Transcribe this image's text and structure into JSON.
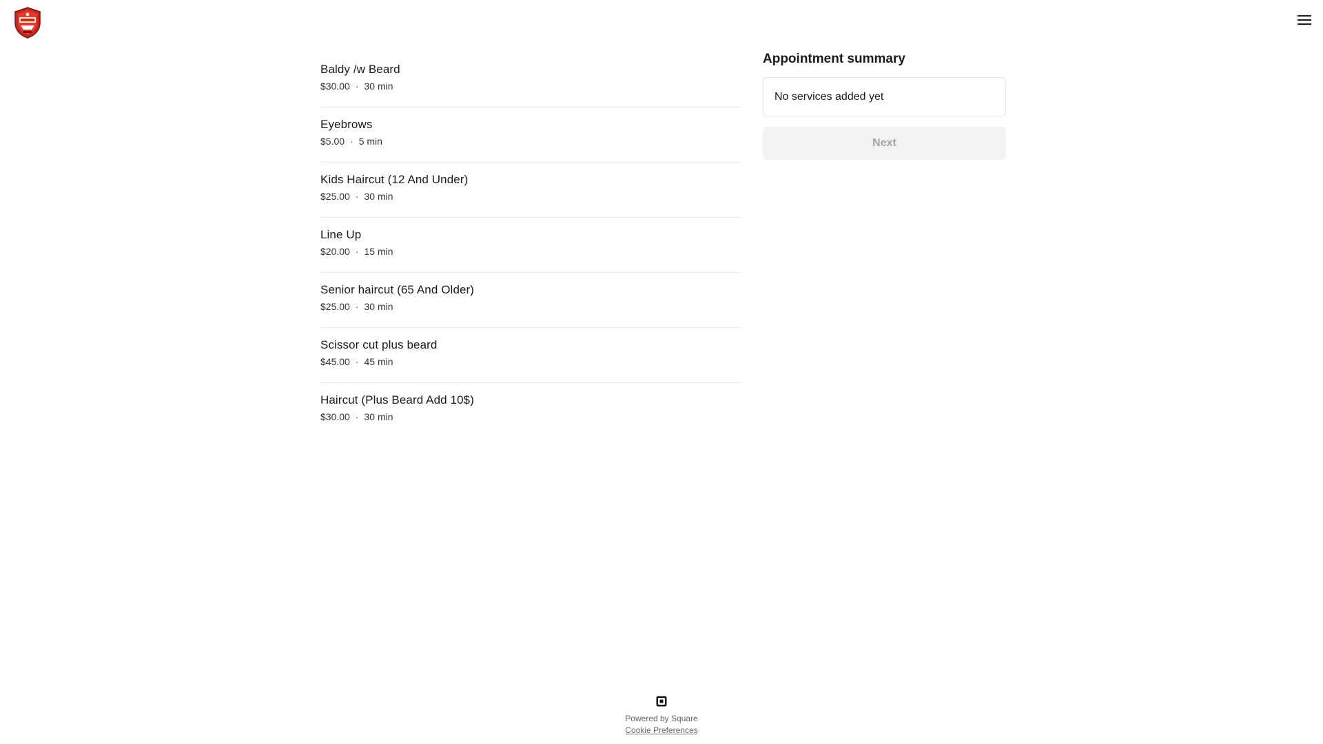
{
  "header": {
    "logo_icon": "barbershop-crest-logo",
    "menu_icon": "hamburger-menu-icon"
  },
  "services": [
    {
      "name": "Baldy /w Beard",
      "price": "$30.00",
      "duration": "30 min"
    },
    {
      "name": "Eyebrows",
      "price": "$5.00",
      "duration": "5 min"
    },
    {
      "name": "Kids Haircut (12 And Under)",
      "price": "$25.00",
      "duration": "30 min"
    },
    {
      "name": "Line Up",
      "price": "$20.00",
      "duration": "15 min"
    },
    {
      "name": "Senior haircut (65 And Older)",
      "price": "$25.00",
      "duration": "30 min"
    },
    {
      "name": "Scissor cut plus beard",
      "price": "$45.00",
      "duration": "45 min"
    },
    {
      "name": "Haircut (Plus Beard Add 10$)",
      "price": "$30.00",
      "duration": "30 min"
    }
  ],
  "meta_separator": "·",
  "summary": {
    "title": "Appointment summary",
    "empty_text": "No services added yet",
    "next_label": "Next"
  },
  "footer": {
    "powered_by": "Powered by Square",
    "cookie_link": "Cookie Preferences",
    "square_icon": "square-logo-icon"
  },
  "colors": {
    "logo_red": "#c8261f",
    "next_bg": "#f2f2f2",
    "next_text": "#a3a3a3"
  }
}
